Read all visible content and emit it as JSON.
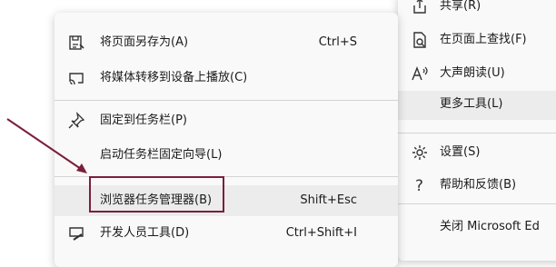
{
  "main_menu": {
    "items": [
      {
        "label": "将页面另存为(A)",
        "shortcut": "Ctrl+S",
        "icon": "save-page-icon"
      },
      {
        "label": "将媒体转移到设备上播放(C)",
        "shortcut": "",
        "icon": "cast-icon"
      },
      {
        "label": "固定到任务栏(P)",
        "shortcut": "",
        "icon": "pin-icon"
      },
      {
        "label": "启动任务栏固定向导(L)",
        "shortcut": "",
        "icon": ""
      },
      {
        "label": "浏览器任务管理器(B)",
        "shortcut": "Shift+Esc",
        "icon": ""
      },
      {
        "label": "开发人员工具(D)",
        "shortcut": "Ctrl+Shift+I",
        "icon": "dev-tools-icon"
      }
    ]
  },
  "sub_menu": {
    "items": [
      {
        "label": "共享(R)",
        "icon": "share-icon"
      },
      {
        "label": "在页面上查找(F)",
        "icon": "find-icon"
      },
      {
        "label": "大声朗读(U)",
        "icon": "read-aloud-icon"
      },
      {
        "label": "更多工具(L)",
        "icon": ""
      },
      {
        "label": "设置(S)",
        "icon": "gear-icon"
      },
      {
        "label": "帮助和反馈(B)",
        "icon": "help-icon"
      },
      {
        "label": "关闭 Microsoft Ed",
        "icon": ""
      }
    ]
  },
  "colors": {
    "annotation": "#7a1f3a",
    "menu_bg": "#f9f9f9",
    "highlight": "#ececec"
  }
}
